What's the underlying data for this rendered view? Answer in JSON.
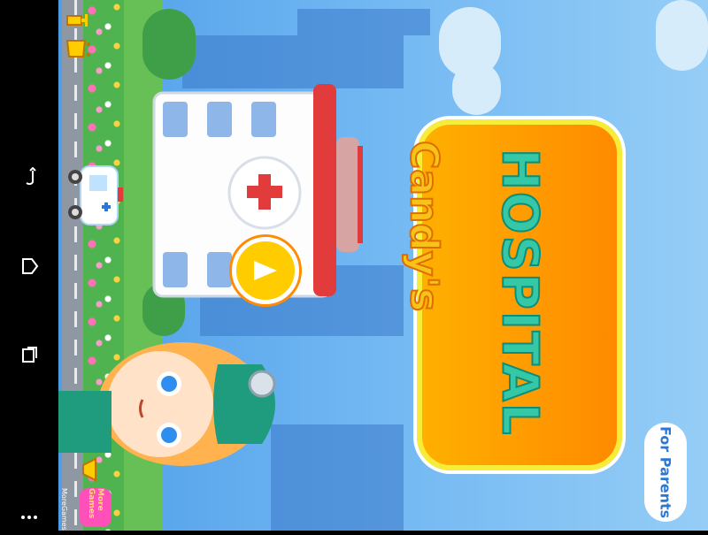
{
  "system_nav": {
    "back_icon": "back-icon",
    "home_icon": "home-icon",
    "recent_icon": "recent-apps-icon",
    "menu_icon": "menu-dots-icon"
  },
  "game": {
    "title_top": "Candy's",
    "title_main": "HOSPITAL",
    "play_label": "",
    "for_parents": "For Parents",
    "more_games": "More Games",
    "more_games_under": "MoreGames"
  },
  "colors": {
    "sky": "#6fb6f2",
    "title_orange": "#ff8a00",
    "title_yellow": "#f7ec37",
    "title_text_green": "#34c8a6",
    "play_yellow": "#ffcc00",
    "parent_blue": "#2a77d6"
  },
  "icons": {
    "trophy": "trophy-icon",
    "cart": "shopping-cart-icon",
    "megaphone": "megaphone-icon",
    "play": "play-icon"
  }
}
